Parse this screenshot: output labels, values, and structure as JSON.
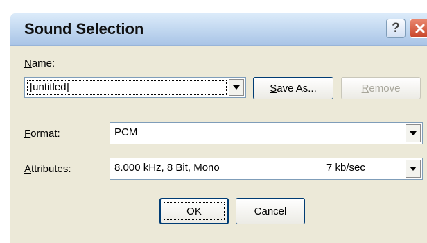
{
  "window": {
    "title": "Sound Selection"
  },
  "titlebar": {
    "help_glyph": "?",
    "close_icon": "close-icon"
  },
  "name": {
    "label_hotkey": "N",
    "label_rest": "ame:",
    "value": "[untitled]"
  },
  "buttons": {
    "save_as_hotkey": "S",
    "save_as_rest": "ave As...",
    "remove_hotkey": "R",
    "remove_rest": "emove",
    "ok": "OK",
    "cancel": "Cancel"
  },
  "format": {
    "label_hotkey": "F",
    "label_rest": "ormat:",
    "value": "PCM"
  },
  "attributes": {
    "label_hotkey": "A",
    "label_rest": "ttributes:",
    "value": "8.000 kHz, 8 Bit, Mono",
    "rate": "7 kb/sec"
  },
  "colors": {
    "dialog_bg": "#ece9d8",
    "close_red": "#c8452a",
    "selection_blue": "#316ac5"
  }
}
